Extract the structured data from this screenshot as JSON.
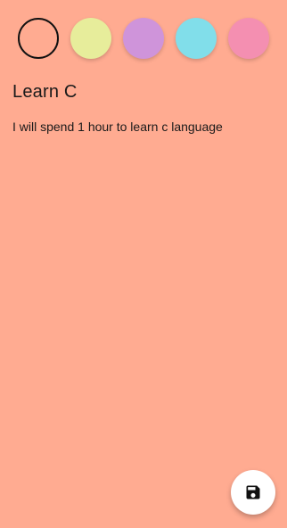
{
  "colors": {
    "background": "#FFAB91",
    "text": "#1A1A1A",
    "fab_background": "#FFFFFF"
  },
  "palette": {
    "swatches": [
      {
        "name": "peach",
        "color": "#FFAB91",
        "selected": true
      },
      {
        "name": "yellow",
        "color": "#E7ED9B",
        "selected": false
      },
      {
        "name": "purple",
        "color": "#CF94DA",
        "selected": false
      },
      {
        "name": "cyan",
        "color": "#81DEEA",
        "selected": false
      },
      {
        "name": "pink",
        "color": "#F48FB1",
        "selected": false
      }
    ]
  },
  "note": {
    "title": "Learn C",
    "body": "I will spend 1 hour to learn c language"
  },
  "fab": {
    "icon": "save-icon"
  }
}
